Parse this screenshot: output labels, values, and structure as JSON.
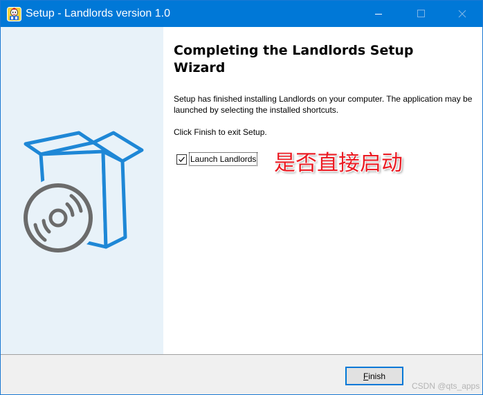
{
  "window": {
    "title": "Setup - Landlords version 1.0",
    "accent_color": "#0078d7",
    "icon": "landlords-app-icon"
  },
  "titlebar_buttons": {
    "minimize_icon": "minimize-icon",
    "maximize_icon": "maximize-icon",
    "close_icon": "close-icon"
  },
  "wizard": {
    "heading": "Completing the Landlords Setup Wizard",
    "body": "Setup has finished installing Landlords on your computer. The application may be launched by selecting the installed shortcuts.",
    "exit_instruction": "Click Finish to exit Setup.",
    "launch_checkbox": {
      "label": "Launch Landlords",
      "checked": true
    },
    "annotation": "是否直接启动",
    "annotation_color": "#ea1c24",
    "graphic": "software-box-cd-icon"
  },
  "footer": {
    "finish_label_mnemonic": "F",
    "finish_label_rest": "inish"
  },
  "watermark": "CSDN @qts_apps"
}
